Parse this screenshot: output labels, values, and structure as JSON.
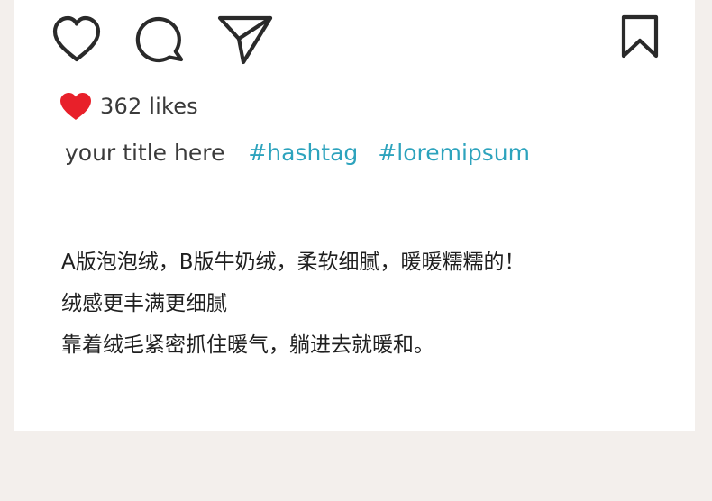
{
  "post": {
    "icons": {
      "like": "heart-outline-icon",
      "comment": "comment-bubble-icon",
      "share": "paper-plane-icon",
      "save": "bookmark-icon",
      "liked": "heart-filled-icon"
    },
    "likes_count": "362 likes",
    "caption_title": "your title here",
    "hashtags": [
      "#hashtag",
      "#loremipsum"
    ],
    "description": [
      "A版泡泡绒，B版牛奶绒，柔软细腻，暖暖糯糯的！",
      "绒感更丰满更细腻",
      "靠着绒毛紧密抓住暖气，躺进去就暖和。"
    ]
  },
  "colors": {
    "background": "#f3efec",
    "card": "#ffffff",
    "icon_stroke": "#2a2a2a",
    "like_red": "#e8202a",
    "hashtag_blue": "#2da3bd",
    "text_dark": "#1f1f1f"
  }
}
